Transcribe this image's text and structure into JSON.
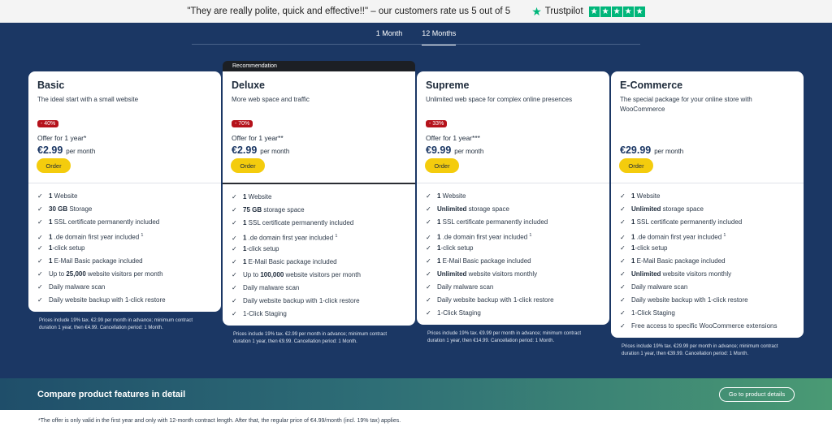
{
  "topbar": {
    "quote": "\"They are really polite, quick and effective!!\" – our customers rate us 5 out of 5",
    "trustpilot_name": "Trustpilot",
    "star_icon": "★"
  },
  "tabs": [
    {
      "label": "1 Month",
      "active": false
    },
    {
      "label": "12 Months",
      "active": true
    }
  ],
  "recommendation_label": "Recommendation",
  "order_label": "Order",
  "plans": [
    {
      "name": "Basic",
      "subtitle": "The ideal start with a small website",
      "badge": "- 40%",
      "offer": "Offer for 1 year*",
      "price": "€2.99",
      "per": "per month",
      "features": [
        {
          "bold": "1",
          "text": " Website"
        },
        {
          "bold": "30 GB",
          "text": " Storage"
        },
        {
          "bold": "1",
          "text": " SSL certificate permanently included"
        },
        {
          "bold": "1",
          "text": " .de domain first year included",
          "sup": "1"
        },
        {
          "bold": "1",
          "text": "-click setup"
        },
        {
          "bold": "1",
          "text": " E-Mail Basic package included"
        },
        {
          "text": "Up to ",
          "bold_after": "25,000",
          "text_after": " website visitors per month"
        },
        {
          "text": "Daily malware scan"
        },
        {
          "text": "Daily website backup with 1-click restore"
        }
      ],
      "note": "Prices include 19% tax. €2.99 per month in advance; minimum contract duration 1 year, then €4.99. Cancellation period: 1 Month."
    },
    {
      "name": "Deluxe",
      "subtitle": "More web space and traffic",
      "badge": "- 70%",
      "offer": "Offer for 1 year**",
      "price": "€2.99",
      "per": "per month",
      "features": [
        {
          "bold": "1",
          "text": " Website"
        },
        {
          "bold": "75 GB",
          "text": " storage space"
        },
        {
          "bold": "1",
          "text": " SSL certificate permanently included"
        },
        {
          "bold": "1",
          "text": " .de domain first year included",
          "sup": "1"
        },
        {
          "bold": "1",
          "text": "-click setup"
        },
        {
          "bold": "1",
          "text": " E-Mail Basic package included"
        },
        {
          "text": "Up to ",
          "bold_after": "100,000",
          "text_after": " website visitors per month"
        },
        {
          "text": "Daily malware scan"
        },
        {
          "text": "Daily website backup with 1-click restore"
        },
        {
          "text": "1-Click Staging"
        }
      ],
      "note": "Prices include 19% tax. €2.99 per month in advance; minimum contract duration 1 year, then €9.99. Cancellation period: 1 Month."
    },
    {
      "name": "Supreme",
      "subtitle": "Unlimited web space for complex online presences",
      "badge": "- 33%",
      "offer": "Offer for 1 year***",
      "price": "€9.99",
      "per": "per month",
      "features": [
        {
          "bold": "1",
          "text": " Website"
        },
        {
          "bold": "Unlimited",
          "text": " storage space"
        },
        {
          "bold": "1",
          "text": " SSL certificate permanently included"
        },
        {
          "bold": "1",
          "text": " .de domain first year included",
          "sup": "1"
        },
        {
          "bold": "1",
          "text": "-click setup"
        },
        {
          "bold": "1",
          "text": " E-Mail Basic package included"
        },
        {
          "bold": "Unlimited",
          "text": " website visitors monthly"
        },
        {
          "text": "Daily malware scan"
        },
        {
          "text": "Daily website backup with 1-click restore"
        },
        {
          "text": "1-Click Staging"
        }
      ],
      "note": "Prices include 19% tax. €9.99 per month in advance; minimum contract duration 1 year, then €14.99. Cancellation period: 1 Month."
    },
    {
      "name": "E-Commerce",
      "subtitle": "The special package for your online store with WooCommerce",
      "badge": "",
      "offer": "",
      "price": "€29.99",
      "per": "per month",
      "features": [
        {
          "bold": "1",
          "text": " Website"
        },
        {
          "bold": "Unlimited",
          "text": " storage space"
        },
        {
          "bold": "1",
          "text": " SSL certificate permanently included"
        },
        {
          "bold": "1",
          "text": " .de domain first year included",
          "sup": "1"
        },
        {
          "bold": "1",
          "text": "-click setup"
        },
        {
          "bold": "1",
          "text": " E-Mail Basic package included"
        },
        {
          "bold": "Unlimited",
          "text": " website visitors monthly"
        },
        {
          "text": "Daily malware scan"
        },
        {
          "text": "Daily website backup with 1-click restore"
        },
        {
          "text": "1-Click Staging"
        },
        {
          "text": "Free access to specific WooCommerce extensions"
        }
      ],
      "note": "Prices include 19% tax. €29.99 per month in advance; minimum contract duration 1 year, then €39.99. Cancellation period: 1 Month."
    }
  ],
  "compare": {
    "title": "Compare product features in detail",
    "button": "Go to product details"
  },
  "bottom_note": "*The offer is only valid in the first year and only with 12-month contract length. After that, the regular price of €4.99/month (incl. 19% tax) applies.",
  "colors": {
    "navy": "#1b3764",
    "order_yellow": "#f4cc0d",
    "badge_red": "#b5121b",
    "trustpilot_green": "#00b67a"
  }
}
